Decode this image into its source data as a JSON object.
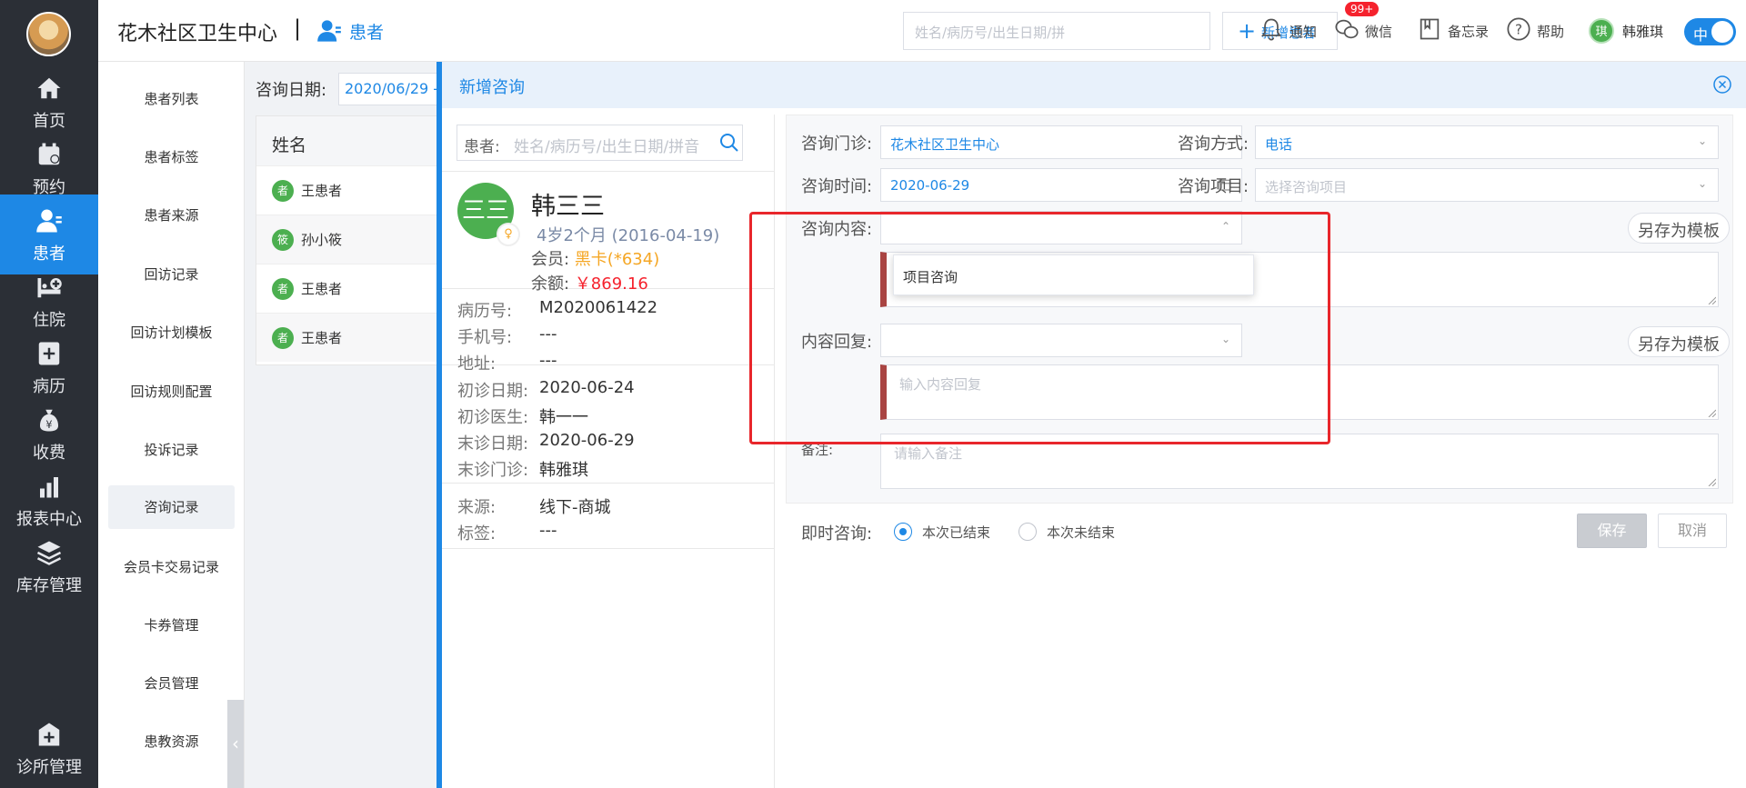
{
  "nav": {
    "items": [
      {
        "label": "首页",
        "icon": "home-icon"
      },
      {
        "label": "预约",
        "icon": "calendar-icon"
      },
      {
        "label": "患者",
        "icon": "patient-icon"
      },
      {
        "label": "住院",
        "icon": "bed-icon"
      },
      {
        "label": "病历",
        "icon": "medical-record-icon"
      },
      {
        "label": "收费",
        "icon": "money-bag-icon"
      },
      {
        "label": "报表中心",
        "icon": "bar-chart-icon"
      },
      {
        "label": "库存管理",
        "icon": "layers-icon"
      },
      {
        "label": "诊所管理",
        "icon": "clinic-icon"
      }
    ],
    "active_index": 2
  },
  "header": {
    "clinic_name": "花木社区卫生中心",
    "separator": "|",
    "breadcrumb": "患者",
    "search_placeholder": "姓名/病历号/出生日期/拼",
    "add_patient": "新增患者",
    "notify": "通知",
    "notify_badge": "99+",
    "wechat": "微信",
    "memo": "备忘录",
    "help": "帮助",
    "user_avatar_text": "琪",
    "user_name": "韩雅琪",
    "lang_toggle": "中"
  },
  "subnav": {
    "items": [
      "患者列表",
      "患者标签",
      "患者来源",
      "回访记录",
      "回访计划模板",
      "回访规则配置",
      "投诉记录",
      "咨询记录",
      "会员卡交易记录",
      "卡券管理",
      "会员管理",
      "患教资源"
    ],
    "active_index": 7,
    "collapse_glyph": "‹"
  },
  "background": {
    "filter_label": "咨询日期:",
    "filter_value": "2020/06/29 -",
    "table_header": "姓名",
    "rows": [
      {
        "avatar": "者",
        "name": "王患者"
      },
      {
        "avatar": "筱",
        "name": "孙小筱"
      },
      {
        "avatar": "者",
        "name": "王患者"
      },
      {
        "avatar": "者",
        "name": "王患者"
      }
    ]
  },
  "drawer": {
    "title": "新增咨询",
    "patient_search_label": "患者:",
    "patient_search_placeholder": "姓名/病历号/出生日期/拼音",
    "patient": {
      "avatar_text": "三三",
      "gender_glyph": "♀",
      "name": "韩三三",
      "age": "4岁2个月 (2016-04-19)",
      "member_label": "会员:",
      "member_value": "黑卡(*634)",
      "balance_label": "余额:",
      "balance_value": "￥869.16"
    },
    "info_groups": [
      [
        {
          "k": "病历号:",
          "v": "M2020061422"
        },
        {
          "k": "手机号:",
          "v": "---"
        },
        {
          "k": "地址:",
          "v": "---"
        }
      ],
      [
        {
          "k": "初诊日期:",
          "v": "2020-06-24"
        },
        {
          "k": "初诊医生:",
          "v": "韩一一"
        },
        {
          "k": "末诊日期:",
          "v": "2020-06-29"
        },
        {
          "k": "末诊门诊:",
          "v": "韩雅琪"
        }
      ],
      [
        {
          "k": "来源:",
          "v": "线下-商城"
        },
        {
          "k": "标签:",
          "v": "---"
        }
      ]
    ],
    "form": {
      "clinic_label": "咨询门诊:",
      "clinic_value": "花木社区卫生中心",
      "method_label": "咨询方式:",
      "method_value": "电话",
      "time_label": "咨询时间:",
      "time_value": "2020-06-29",
      "item_label": "咨询项目:",
      "item_placeholder": "选择咨询项目",
      "content_label": "咨询内容:",
      "content_dropdown_option": "项目咨询",
      "save_template_1": "另存为模板",
      "reply_label": "内容回复:",
      "reply_placeholder": "输入内容回复",
      "save_template_2": "另存为模板",
      "remark_label": "备注:",
      "remark_placeholder": "请输入备注",
      "instant_label": "即时咨询:",
      "radio_ended": "本次已结束",
      "radio_not_ended": "本次未结束",
      "save": "保存",
      "cancel": "取消"
    }
  },
  "colors": {
    "accent": "#1e88e5",
    "nav_bg": "#2b2f36",
    "avatar_green": "#4caf50",
    "member_orange": "#f5a623",
    "balance_red": "#f5222d",
    "highlight_box": "#e8262b",
    "required_bar": "#a94442"
  }
}
